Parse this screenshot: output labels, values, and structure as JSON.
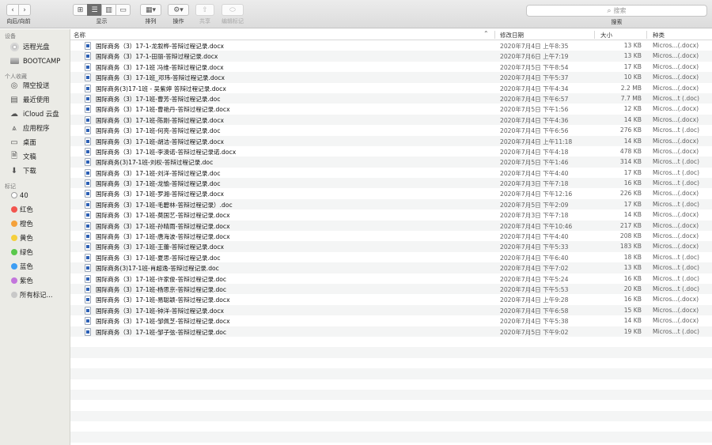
{
  "toolbar": {
    "nav_label": "向后/向前",
    "view_label": "显示",
    "arrange_label": "排列",
    "action_label": "操作",
    "share_label": "共享",
    "tags_label": "编辑标记",
    "search_placeholder": "搜索",
    "search_label": "搜索"
  },
  "sidebar": {
    "devices_heading": "设备",
    "devices": [
      "远程光盘",
      "BOOTCAMP"
    ],
    "favorites_heading": "个人收藏",
    "favorites": [
      {
        "label": "隔空投送",
        "icon": "airdrop-icon"
      },
      {
        "label": "最近使用",
        "icon": "recents-icon"
      },
      {
        "label": "iCloud 云盘",
        "icon": "icloud-icon"
      },
      {
        "label": "应用程序",
        "icon": "applications-icon"
      },
      {
        "label": "桌面",
        "icon": "desktop-icon"
      },
      {
        "label": "文稿",
        "icon": "documents-icon"
      },
      {
        "label": "下载",
        "icon": "downloads-icon"
      }
    ],
    "tags_heading": "标记",
    "tags": [
      {
        "label": "40",
        "color": "#ffffff"
      },
      {
        "label": "红色",
        "color": "#f2554f"
      },
      {
        "label": "橙色",
        "color": "#f4a13b"
      },
      {
        "label": "黄色",
        "color": "#f5cf3c"
      },
      {
        "label": "绿色",
        "color": "#5ac84c"
      },
      {
        "label": "蓝色",
        "color": "#3d9ef4"
      },
      {
        "label": "紫色",
        "color": "#c376dc"
      },
      {
        "label": "所有标记...",
        "color": "#c8c8c8"
      }
    ]
  },
  "columns": {
    "name": "名称",
    "date": "修改日期",
    "size": "大小",
    "kind": "种类"
  },
  "files": [
    {
      "name": "国际商务（3）17-1-龙叙桦-答辩过程记录.docx",
      "date": "2020年7月4日 上午8:35",
      "size": "13 KB",
      "kind": "Micros...(.docx)"
    },
    {
      "name": "国际商务（3）17-1-田丽-答辩过程记录.docx",
      "date": "2020年7月6日 上午7:19",
      "size": "13 KB",
      "kind": "Micros...(.docx)"
    },
    {
      "name": "国际商务（3）17-1班 冯维-答辩过程记录.docx",
      "date": "2020年7月5日 下午8:54",
      "size": "17 KB",
      "kind": "Micros...(.docx)"
    },
    {
      "name": "国际商务（3）17-1班_邓玮-答辩过程记录.docx",
      "date": "2020年7月4日 下午5:37",
      "size": "10 KB",
      "kind": "Micros...(.docx)"
    },
    {
      "name": "国际商务(3)17-1班 - 吴紫婷 答辩过程记录.docx",
      "date": "2020年7月4日 下午4:34",
      "size": "2.2 MB",
      "kind": "Micros...(.docx)"
    },
    {
      "name": "国际商务（3）17-1班-曹芳-答辩过程记录.doc",
      "date": "2020年7月4日 下午6:57",
      "size": "7.7 MB",
      "kind": "Micros...t (.doc)"
    },
    {
      "name": "国际商务（3）17-1班-曹艳丹-答辩过程记录.docx",
      "date": "2020年7月5日 下午1:56",
      "size": "12 KB",
      "kind": "Micros...(.docx)"
    },
    {
      "name": "国际商务（3）17-1班-陈刚-答辩过程记录.docx",
      "date": "2020年7月4日 下午4:36",
      "size": "14 KB",
      "kind": "Micros...(.docx)"
    },
    {
      "name": "国际商务（3）17-1班-何亮-答辩过程记录.doc",
      "date": "2020年7月4日 下午6:56",
      "size": "276 KB",
      "kind": "Micros...t (.doc)"
    },
    {
      "name": "国际商务（3）17-1班-胡洁-答辩过程记录.docx",
      "date": "2020年7月4日 上午11:18",
      "size": "14 KB",
      "kind": "Micros...(.docx)"
    },
    {
      "name": "国际商务（3）17-1班-李澳诺-答辩过程记录诺.docx",
      "date": "2020年7月4日 下午4:18",
      "size": "478 KB",
      "kind": "Micros...(.docx)"
    },
    {
      "name": "国际商务(3)17-1班-刘权-答辩过程记录.doc",
      "date": "2020年7月5日 下午1:46",
      "size": "314 KB",
      "kind": "Micros...t (.doc)"
    },
    {
      "name": "国际商务（3）17-1班-刘洋-答辩过程记录.doc",
      "date": "2020年7月4日 下午4:40",
      "size": "17 KB",
      "kind": "Micros...t (.doc)"
    },
    {
      "name": "国际商务（3）17-1班-龙愉-答辩过程记录.doc",
      "date": "2020年7月3日 下午7:18",
      "size": "16 KB",
      "kind": "Micros...t (.doc)"
    },
    {
      "name": "国际商务（3）17-1班-罗湘-答辩过程记录.docx",
      "date": "2020年7月4日 下午12:16",
      "size": "226 KB",
      "kind": "Micros...(.docx)"
    },
    {
      "name": "国际商务（3）17-1班-毛碧林-答辩过程记录）.doc",
      "date": "2020年7月5日 下午2:09",
      "size": "17 KB",
      "kind": "Micros...t (.doc)"
    },
    {
      "name": "国际商务（3）17-1班-莫国艺-答辩过程记录.docx",
      "date": "2020年7月3日 下午7:18",
      "size": "14 KB",
      "kind": "Micros...(.docx)"
    },
    {
      "name": "国际商务（3）17-1班-孙晴雨-答辩过程记录.docx",
      "date": "2020年7月4日 下午10:46",
      "size": "217 KB",
      "kind": "Micros...(.docx)"
    },
    {
      "name": "国际商务（3）17-1班-唐海波-答辩过程记录.docx",
      "date": "2020年7月4日 下午4:40",
      "size": "208 KB",
      "kind": "Micros...(.docx)"
    },
    {
      "name": "国际商务（3）17-1班-王蕾-答辩过程记录.docx",
      "date": "2020年7月4日 下午5:33",
      "size": "183 KB",
      "kind": "Micros...(.docx)"
    },
    {
      "name": "国际商务（3）17-1班-夏思-答辩过程记录.doc",
      "date": "2020年7月4日 下午6:40",
      "size": "18 KB",
      "kind": "Micros...t (.doc)"
    },
    {
      "name": "国际商务(3)17-1班-肖超逸-答辩过程记录.doc",
      "date": "2020年7月4日 下午7:02",
      "size": "13 KB",
      "kind": "Micros...t (.doc)"
    },
    {
      "name": "国际商务（3）17-1班-许家俊-答辩过程记录.doc",
      "date": "2020年7月4日 下午5:24",
      "size": "16 KB",
      "kind": "Micros...t (.doc)"
    },
    {
      "name": "国际商务（3）17-1班-杨思京-答辩过程记录.doc",
      "date": "2020年7月4日 下午5:53",
      "size": "20 KB",
      "kind": "Micros...t (.doc)"
    },
    {
      "name": "国际商务（3）17-1班-易聪颖-答辩过程记录.docx",
      "date": "2020年7月4日 上午9:28",
      "size": "16 KB",
      "kind": "Micros...(.docx)"
    },
    {
      "name": "国际商务（3）17-1班-钟洋-答辩过程记录.docx",
      "date": "2020年7月4日 下午6:58",
      "size": "15 KB",
      "kind": "Micros...(.docx)"
    },
    {
      "name": "国际商务（3）17-1班-邹佩芝-答辩过程记录.docx",
      "date": "2020年7月4日 下午5:38",
      "size": "14 KB",
      "kind": "Micros...(.docx)"
    },
    {
      "name": "国际商务（3）17-1班-邹子弦-答辩过程记录.doc",
      "date": "2020年7月5日 下午9:02",
      "size": "19 KB",
      "kind": "Micros...t (.doc)"
    }
  ]
}
